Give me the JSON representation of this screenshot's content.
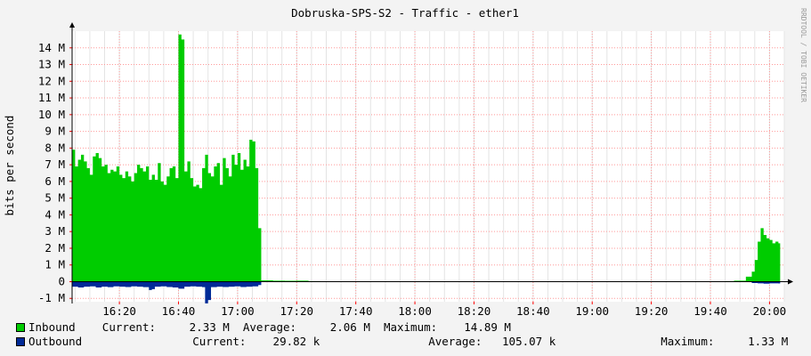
{
  "chart_data": {
    "type": "area",
    "title": "Dobruska-SPS-S2 - Traffic - ether1",
    "watermark": "RRDTOOL / TOBI OETIKER",
    "ylabel": "bits per second",
    "ylim": [
      -1200000,
      15000000
    ],
    "y_ticks": [
      {
        "value": -1000000,
        "label": "-1 M"
      },
      {
        "value": 0,
        "label": "0"
      },
      {
        "value": 1000000,
        "label": "1 M"
      },
      {
        "value": 2000000,
        "label": "2 M"
      },
      {
        "value": 3000000,
        "label": "3 M"
      },
      {
        "value": 4000000,
        "label": "4 M"
      },
      {
        "value": 5000000,
        "label": "5 M"
      },
      {
        "value": 6000000,
        "label": "6 M"
      },
      {
        "value": 7000000,
        "label": "7 M"
      },
      {
        "value": 8000000,
        "label": "8 M"
      },
      {
        "value": 9000000,
        "label": "9 M"
      },
      {
        "value": 10000000,
        "label": "10 M"
      },
      {
        "value": 11000000,
        "label": "11 M"
      },
      {
        "value": 12000000,
        "label": "12 M"
      },
      {
        "value": 13000000,
        "label": "13 M"
      },
      {
        "value": 14000000,
        "label": "14 M"
      }
    ],
    "xlim": [
      "16:04",
      "20:05"
    ],
    "x_ticks": [
      "16:20",
      "16:40",
      "17:00",
      "17:20",
      "17:40",
      "18:00",
      "18:20",
      "18:40",
      "19:00",
      "19:20",
      "19:40",
      "20:00"
    ],
    "grid": true,
    "series": [
      {
        "name": "Inbound",
        "color": "#00cc00",
        "points": [
          [
            "16:04",
            7900000
          ],
          [
            "16:05",
            6900000
          ],
          [
            "16:06",
            7300000
          ],
          [
            "16:07",
            7600000
          ],
          [
            "16:08",
            7200000
          ],
          [
            "16:09",
            6800000
          ],
          [
            "16:10",
            6400000
          ],
          [
            "16:11",
            7500000
          ],
          [
            "16:12",
            7700000
          ],
          [
            "16:13",
            7400000
          ],
          [
            "16:14",
            6900000
          ],
          [
            "16:15",
            7000000
          ],
          [
            "16:16",
            6500000
          ],
          [
            "16:17",
            6700000
          ],
          [
            "16:18",
            6600000
          ],
          [
            "16:19",
            6900000
          ],
          [
            "16:20",
            6400000
          ],
          [
            "16:21",
            6200000
          ],
          [
            "16:22",
            6600000
          ],
          [
            "16:23",
            6300000
          ],
          [
            "16:24",
            6000000
          ],
          [
            "16:25",
            6500000
          ],
          [
            "16:26",
            7000000
          ],
          [
            "16:27",
            6800000
          ],
          [
            "16:28",
            6600000
          ],
          [
            "16:29",
            6900000
          ],
          [
            "16:30",
            6100000
          ],
          [
            "16:31",
            6400000
          ],
          [
            "16:32",
            6100000
          ],
          [
            "16:33",
            7100000
          ],
          [
            "16:34",
            6000000
          ],
          [
            "16:35",
            5800000
          ],
          [
            "16:36",
            6300000
          ],
          [
            "16:37",
            6800000
          ],
          [
            "16:38",
            6900000
          ],
          [
            "16:39",
            6200000
          ],
          [
            "16:40",
            14800000
          ],
          [
            "16:41",
            14500000
          ],
          [
            "16:42",
            6600000
          ],
          [
            "16:43",
            7200000
          ],
          [
            "16:44",
            6200000
          ],
          [
            "16:45",
            5700000
          ],
          [
            "16:46",
            5800000
          ],
          [
            "16:47",
            5600000
          ],
          [
            "16:48",
            6800000
          ],
          [
            "16:49",
            7600000
          ],
          [
            "16:50",
            6500000
          ],
          [
            "16:51",
            6300000
          ],
          [
            "16:52",
            6900000
          ],
          [
            "16:53",
            7100000
          ],
          [
            "16:54",
            5800000
          ],
          [
            "16:55",
            7400000
          ],
          [
            "16:56",
            6800000
          ],
          [
            "16:57",
            6300000
          ],
          [
            "16:58",
            7600000
          ],
          [
            "16:59",
            7000000
          ],
          [
            "17:00",
            7700000
          ],
          [
            "17:01",
            6700000
          ],
          [
            "17:02",
            7300000
          ],
          [
            "17:03",
            6900000
          ],
          [
            "17:04",
            8500000
          ],
          [
            "17:05",
            8400000
          ],
          [
            "17:06",
            6800000
          ],
          [
            "17:07",
            3200000
          ],
          [
            "17:08",
            80000
          ],
          [
            "17:12",
            60000
          ],
          [
            "17:16",
            50000
          ],
          [
            "17:20",
            60000
          ],
          [
            "17:24",
            30000
          ],
          [
            "17:28",
            20000
          ],
          [
            "17:40",
            0
          ],
          [
            "18:05",
            20000
          ],
          [
            "18:30",
            0
          ],
          [
            "18:40",
            20000
          ],
          [
            "18:45",
            10000
          ],
          [
            "18:58",
            20000
          ],
          [
            "19:10",
            0
          ],
          [
            "19:24",
            20000
          ],
          [
            "19:40",
            20000
          ],
          [
            "19:45",
            30000
          ],
          [
            "19:48",
            60000
          ],
          [
            "19:52",
            300000
          ],
          [
            "19:54",
            600000
          ],
          [
            "19:55",
            1300000
          ],
          [
            "19:56",
            2400000
          ],
          [
            "19:57",
            3200000
          ],
          [
            "19:58",
            2800000
          ],
          [
            "19:59",
            2600000
          ],
          [
            "20:00",
            2500000
          ],
          [
            "20:01",
            2300000
          ],
          [
            "20:02",
            2400000
          ],
          [
            "20:03",
            2300000
          ]
        ]
      },
      {
        "name": "Outbound",
        "color": "#002a97",
        "points": [
          [
            "16:04",
            -300000
          ],
          [
            "16:06",
            -350000
          ],
          [
            "16:08",
            -300000
          ],
          [
            "16:10",
            -280000
          ],
          [
            "16:12",
            -350000
          ],
          [
            "16:14",
            -300000
          ],
          [
            "16:16",
            -330000
          ],
          [
            "16:18",
            -280000
          ],
          [
            "16:20",
            -300000
          ],
          [
            "16:22",
            -320000
          ],
          [
            "16:24",
            -280000
          ],
          [
            "16:26",
            -300000
          ],
          [
            "16:28",
            -330000
          ],
          [
            "16:30",
            -500000
          ],
          [
            "16:31",
            -450000
          ],
          [
            "16:32",
            -300000
          ],
          [
            "16:34",
            -280000
          ],
          [
            "16:36",
            -320000
          ],
          [
            "16:38",
            -350000
          ],
          [
            "16:40",
            -420000
          ],
          [
            "16:42",
            -300000
          ],
          [
            "16:44",
            -280000
          ],
          [
            "16:46",
            -300000
          ],
          [
            "16:48",
            -330000
          ],
          [
            "16:49",
            -1300000
          ],
          [
            "16:50",
            -1100000
          ],
          [
            "16:51",
            -330000
          ],
          [
            "16:53",
            -300000
          ],
          [
            "16:55",
            -320000
          ],
          [
            "16:57",
            -300000
          ],
          [
            "16:59",
            -280000
          ],
          [
            "17:01",
            -320000
          ],
          [
            "17:03",
            -300000
          ],
          [
            "17:05",
            -280000
          ],
          [
            "17:07",
            -200000
          ],
          [
            "17:08",
            0
          ],
          [
            "19:52",
            0
          ],
          [
            "19:54",
            -80000
          ],
          [
            "19:56",
            -100000
          ],
          [
            "19:58",
            -120000
          ],
          [
            "20:00",
            -100000
          ],
          [
            "20:03",
            -110000
          ]
        ]
      }
    ]
  },
  "legend": {
    "inbound": {
      "label": "Inbound",
      "current_label": "Current:",
      "current": "2.33 M",
      "average_label": "Average:",
      "average": "2.06 M",
      "maximum_label": "Maximum:",
      "maximum": "14.89 M",
      "color": "#00cc00"
    },
    "outbound": {
      "label": "Outbound",
      "current_label": "Current:",
      "current": "29.82 k",
      "average_label": "Average:",
      "average": "105.07 k",
      "maximum_label": "Maximum:",
      "maximum": "1.33 M",
      "color": "#002a97"
    }
  }
}
